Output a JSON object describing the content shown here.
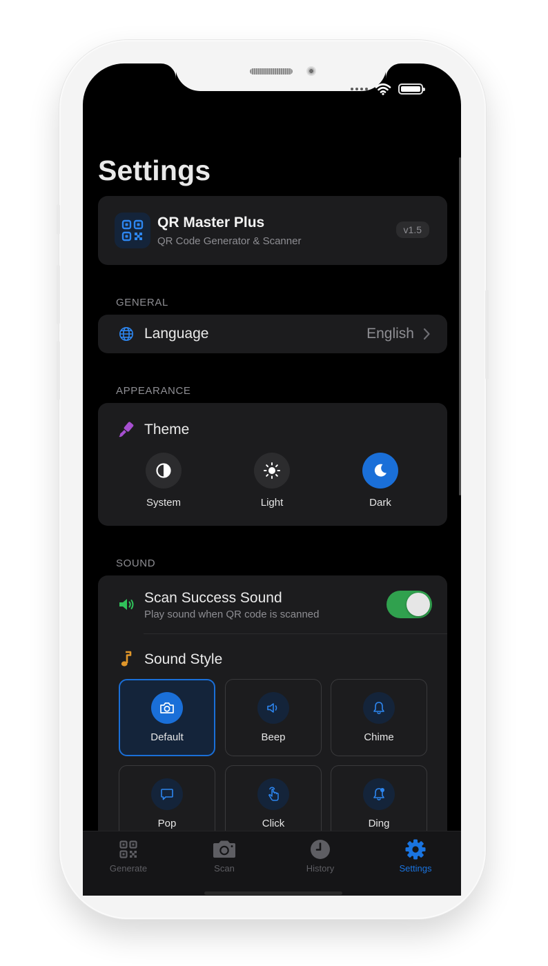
{
  "status_bar": {},
  "page": {
    "title": "Settings"
  },
  "app_info": {
    "name": "QR Master Plus",
    "subtitle": "QR Code Generator & Scanner",
    "version": "v1.5"
  },
  "general": {
    "header": "GENERAL",
    "language": {
      "label": "Language",
      "value": "English"
    }
  },
  "appearance": {
    "header": "APPEARANCE",
    "theme_label": "Theme",
    "options": [
      {
        "label": "System"
      },
      {
        "label": "Light"
      },
      {
        "label": "Dark"
      }
    ],
    "selected": "Dark"
  },
  "sound": {
    "header": "SOUND",
    "scan_success": {
      "label": "Scan Success Sound",
      "description": "Play sound when QR code is scanned",
      "enabled": true
    },
    "style_label": "Sound Style",
    "styles": [
      {
        "label": "Default",
        "icon": "camera-icon"
      },
      {
        "label": "Beep",
        "icon": "speaker-icon"
      },
      {
        "label": "Chime",
        "icon": "bell-icon"
      },
      {
        "label": "Pop",
        "icon": "chat-bubble-icon"
      },
      {
        "label": "Click",
        "icon": "tap-hand-icon"
      },
      {
        "label": "Ding",
        "icon": "bell-dot-icon"
      }
    ],
    "selected_style": "Default"
  },
  "tabbar": {
    "tabs": [
      {
        "label": "Generate",
        "icon": "qr-code-icon"
      },
      {
        "label": "Scan",
        "icon": "camera-icon"
      },
      {
        "label": "History",
        "icon": "clock-icon"
      },
      {
        "label": "Settings",
        "icon": "gear-icon"
      }
    ],
    "active": "Settings"
  },
  "colors": {
    "accent": "#1a6fd8",
    "background": "#000000",
    "card": "#1c1c1e",
    "toggle_on": "#30a14e",
    "theme_icon": "#a64fd0",
    "sound_icon": "#30c15a",
    "music_icon": "#e0962a"
  }
}
